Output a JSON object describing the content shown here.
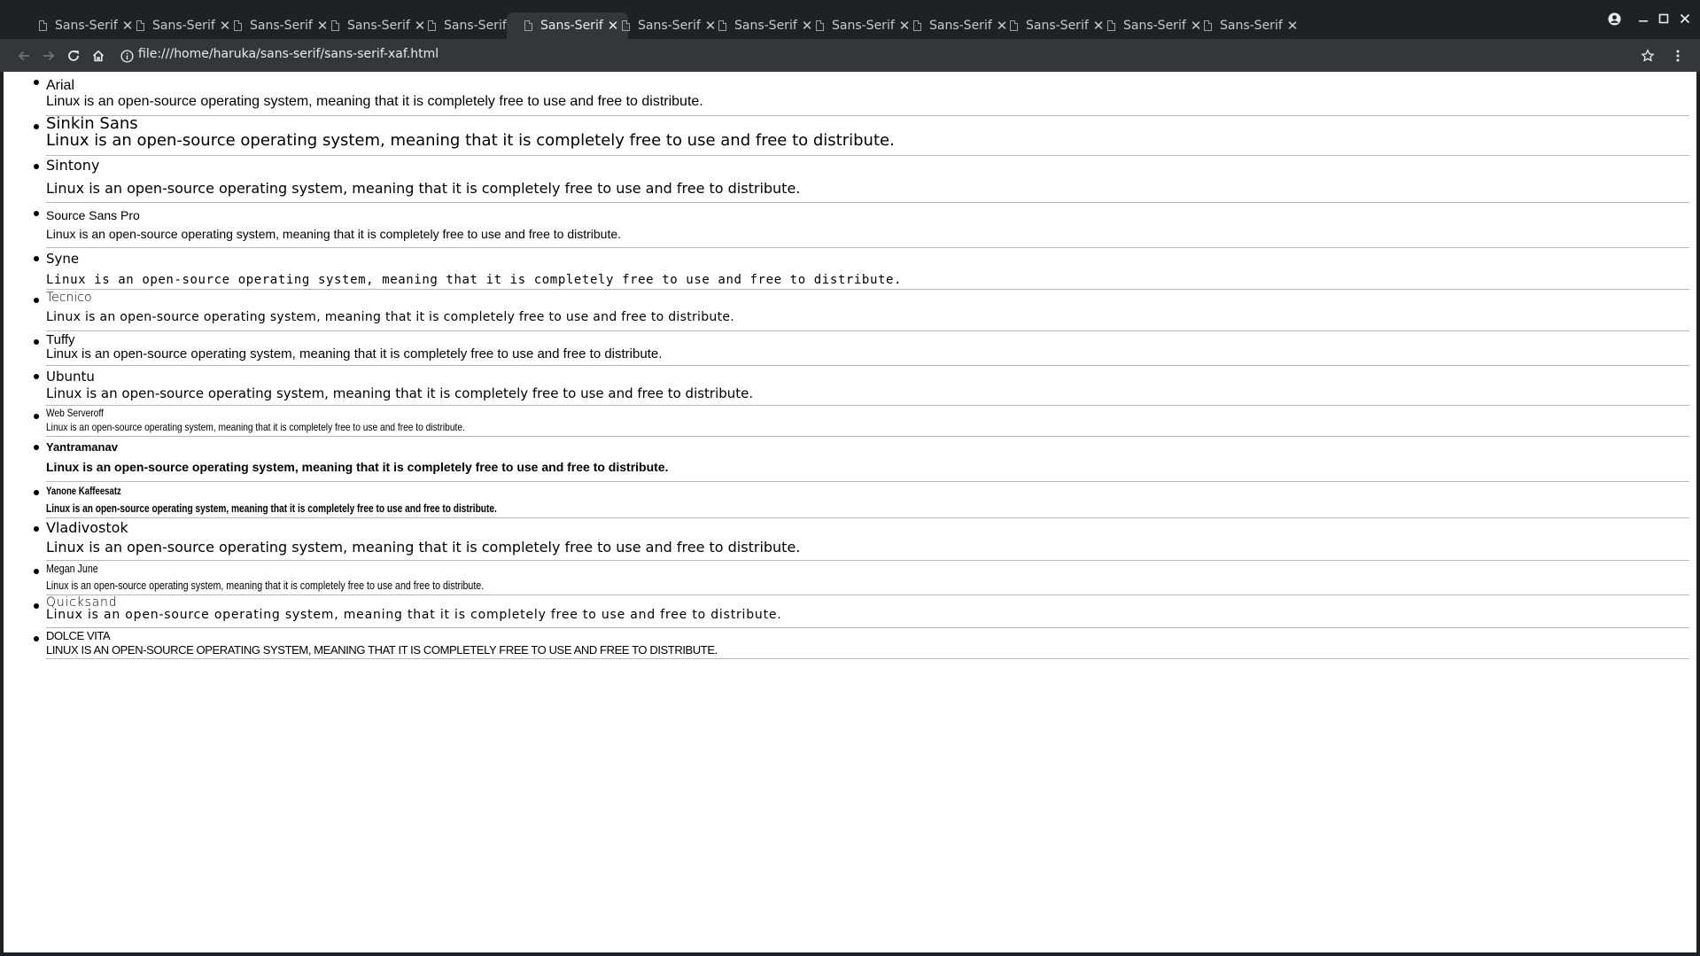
{
  "browser": {
    "tabs": [
      {
        "title": "Sans-Serif",
        "active": false
      },
      {
        "title": "Sans-Serif",
        "active": false
      },
      {
        "title": "Sans-Serif",
        "active": false
      },
      {
        "title": "Sans-Serif",
        "active": false
      },
      {
        "title": "Sans-Serif",
        "active": false
      },
      {
        "title": "Sans-Serif",
        "active": true
      },
      {
        "title": "Sans-Serif",
        "active": false
      },
      {
        "title": "Sans-Serif",
        "active": false
      },
      {
        "title": "Sans-Serif",
        "active": false
      },
      {
        "title": "Sans-Serif",
        "active": false
      },
      {
        "title": "Sans-Serif",
        "active": false
      },
      {
        "title": "Sans-Serif",
        "active": false
      },
      {
        "title": "Sans-Serif",
        "active": false
      }
    ],
    "url": "file:///home/haruka/sans-serif/sans-serif-xaf.html",
    "icons": {
      "back": "arrow-left-icon",
      "forward": "arrow-right-icon",
      "reload": "reload-icon",
      "home": "home-icon",
      "info": "info-icon",
      "star": "star-icon",
      "menu": "kebab-menu-icon",
      "profile": "account-icon",
      "minimize": "minimize-icon",
      "maximize": "maximize-icon",
      "close": "close-icon"
    },
    "colors": {
      "tabstrip": "#202124",
      "toolbar": "#35363a",
      "text": "#e8eaed"
    }
  },
  "fonts": [
    {
      "name": "Arial",
      "sample": "Linux is an open-source operating system, meaning that it is completely free to use and free to distribute."
    },
    {
      "name": "Sinkin Sans",
      "sample": "Linux is an open-source operating system, meaning that it is completely free to use and free to distribute."
    },
    {
      "name": "Sintony",
      "sample": "Linux is an open-source operating system, meaning that it is completely free to use and free to distribute."
    },
    {
      "name": "Source Sans Pro",
      "sample": "Linux is an open-source operating system, meaning that it is completely free to use and free to distribute."
    },
    {
      "name": "Syne",
      "sample": "Linux is an open-source operating system, meaning that it is completely free to use and free to distribute."
    },
    {
      "name": "Tecnico",
      "sample": "Linux is an open-source operating system, meaning that it is completely free to use and free to distribute."
    },
    {
      "name": "Tuffy",
      "sample": "Linux is an open-source operating system, meaning that it is completely free to use and free to distribute."
    },
    {
      "name": "Ubuntu",
      "sample": "Linux is an open-source operating system, meaning that it is completely free to use and free to distribute."
    },
    {
      "name": "Web Serveroff",
      "sample": "Linux is an open-source operating system, meaning that it is completely free to use and free to distribute."
    },
    {
      "name": "Yantramanav",
      "sample": "Linux is an open-source operating system, meaning that it is completely free to use and free to distribute."
    },
    {
      "name": "Yanone Kaffeesatz",
      "sample": "Linux is an open-source operating system, meaning that it is completely free to use and free to distribute."
    },
    {
      "name": "Vladivostok",
      "sample": "Linux is an open-source operating system, meaning that it is completely free to use and free to distribute."
    },
    {
      "name": "Megan June",
      "sample": "Linux is an open-source operating system, meaning that it is completely free to use and free to distribute."
    },
    {
      "name": "Quicksand",
      "sample": "Linux is an open-source operating system, meaning that it is completely free to use and free to distribute."
    },
    {
      "name": "DOLCE VITA",
      "sample": "LINUX IS AN OPEN-SOURCE OPERATING SYSTEM, MEANING THAT IT IS COMPLETELY FREE TO USE AND FREE TO DISTRIBUTE."
    }
  ]
}
